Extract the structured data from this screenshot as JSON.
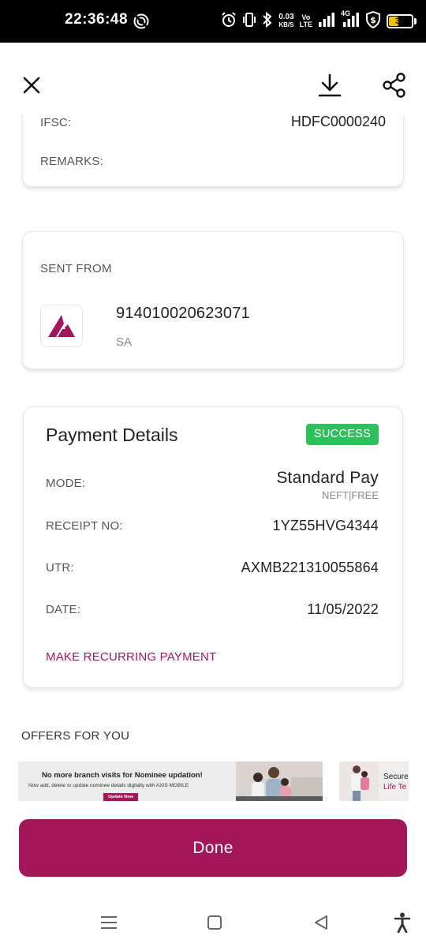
{
  "status_bar": {
    "time": "22:36:48",
    "net_speed_value": "0.03",
    "net_speed_unit": "KB/S",
    "volte_top": "Vo",
    "volte_bottom": "LTE",
    "network_type": "4G",
    "battery": "37"
  },
  "toolbar": {
    "close_icon": "close-icon",
    "download_icon": "download-icon",
    "share_icon": "share-icon"
  },
  "bank_details": {
    "ifsc_label": "IFSC:",
    "ifsc_value": "HDFC0000240",
    "remarks_label": "REMARKS:",
    "remarks_value": ""
  },
  "sent_from": {
    "label": "SENT FROM",
    "account_number": "914010020623071",
    "account_name": "SA"
  },
  "payment_details": {
    "title": "Payment Details",
    "status": "SUCCESS",
    "mode_label": "MODE:",
    "mode_value": "Standard Pay",
    "mode_sub": "NEFT|FREE",
    "receipt_label": "RECEIPT NO:",
    "receipt_value": "1YZ55HVG4344",
    "utr_label": "UTR:",
    "utr_value": "AXMB221310055864",
    "date_label": "DATE:",
    "date_value": "11/05/2022",
    "recurring_link": "MAKE RECURRING PAYMENT"
  },
  "offers": {
    "label": "OFFERS FOR YOU",
    "banner1_head": "No more branch visits for Nominee updation!",
    "banner1_sub": "Now add, delete or update nominee details digitally with AXIS MOBILE",
    "banner1_button": "Update Now",
    "banner2_line1": "Secure",
    "banner2_line2": "Life Te"
  },
  "done_button": "Done",
  "colors": {
    "brand": "#a3165a",
    "success": "#2cc15b"
  }
}
